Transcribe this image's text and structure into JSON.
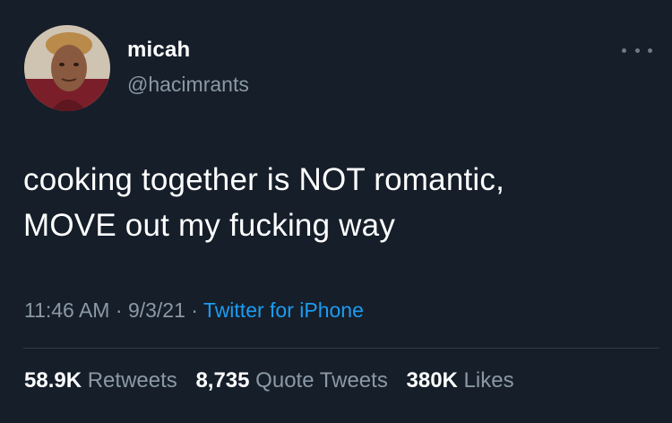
{
  "user": {
    "display_name": "micah",
    "handle": "@hacimrants",
    "avatar_icon": "profile-photo"
  },
  "tweet": {
    "lines": [
      "cooking together is NOT romantic,",
      "MOVE out my fucking way"
    ]
  },
  "meta": {
    "time": "11:46 AM",
    "sep1": " · ",
    "date": "9/3/21",
    "sep2": " · ",
    "source": "Twitter for iPhone"
  },
  "stats": {
    "retweets_count": "58.9K",
    "retweets_label": "Retweets",
    "quotes_count": "8,735",
    "quotes_label": "Quote Tweets",
    "likes_count": "380K",
    "likes_label": "Likes"
  },
  "colors": {
    "background": "#151e29",
    "secondary_text": "#8b98a5",
    "link": "#1d9bf0"
  }
}
